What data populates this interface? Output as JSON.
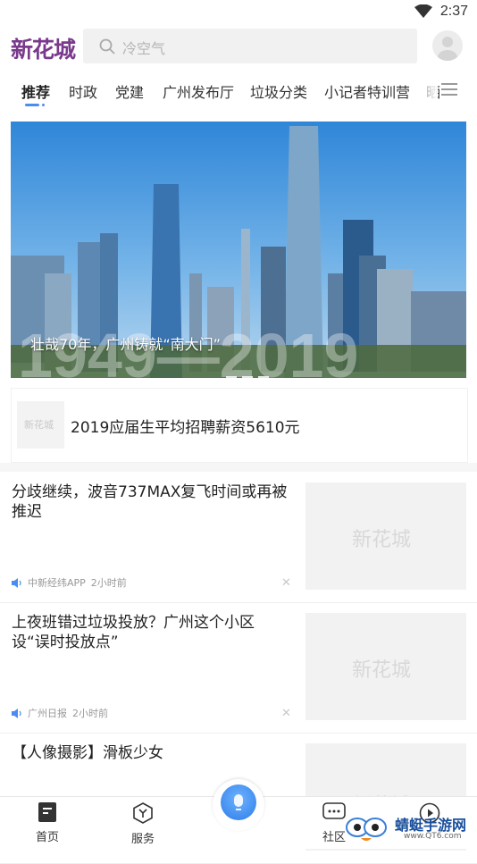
{
  "status_bar": {
    "time": "2:37"
  },
  "header": {
    "logo": "新花城",
    "search_placeholder": "冷空气"
  },
  "tabs": [
    {
      "label": "推荐",
      "active": true
    },
    {
      "label": "时政"
    },
    {
      "label": "党建"
    },
    {
      "label": "广州发布厅"
    },
    {
      "label": "垃圾分类"
    },
    {
      "label": "小记者特训营"
    },
    {
      "label": "晒"
    }
  ],
  "banner": {
    "caption": "壮哉70年，广州铸就“南大门”",
    "image_text": "1949—2019",
    "dots": 3
  },
  "promo": {
    "thumb_text": "新花城",
    "title": "2019应届生平均招聘薪资5610元"
  },
  "news": [
    {
      "title": "分歧继续，波音737MAX复飞时间或再被推迟",
      "source": "中新经纬APP",
      "time": "2小时前",
      "image_text": "新花城"
    },
    {
      "title": "上夜班错过垃圾投放？广州这个小区设“误时投放点”",
      "source": "广州日报",
      "time": "2小时前",
      "image_text": "新花城"
    },
    {
      "title": "【人像摄影】滑板少女",
      "source": "",
      "time": "",
      "image_text": "新花城"
    }
  ],
  "bottom_nav": [
    {
      "label": "首页",
      "icon": "home-doc-icon"
    },
    {
      "label": "服务",
      "icon": "service-icon"
    },
    {
      "label": "社区",
      "icon": "chat-icon"
    },
    {
      "label": "",
      "icon": "play-icon"
    }
  ],
  "watermark": {
    "brand": "蜻蜓手游网",
    "url": "www.QT6.com"
  },
  "colors": {
    "accent": "#4a8df0",
    "logo": "#7a3a8c"
  }
}
